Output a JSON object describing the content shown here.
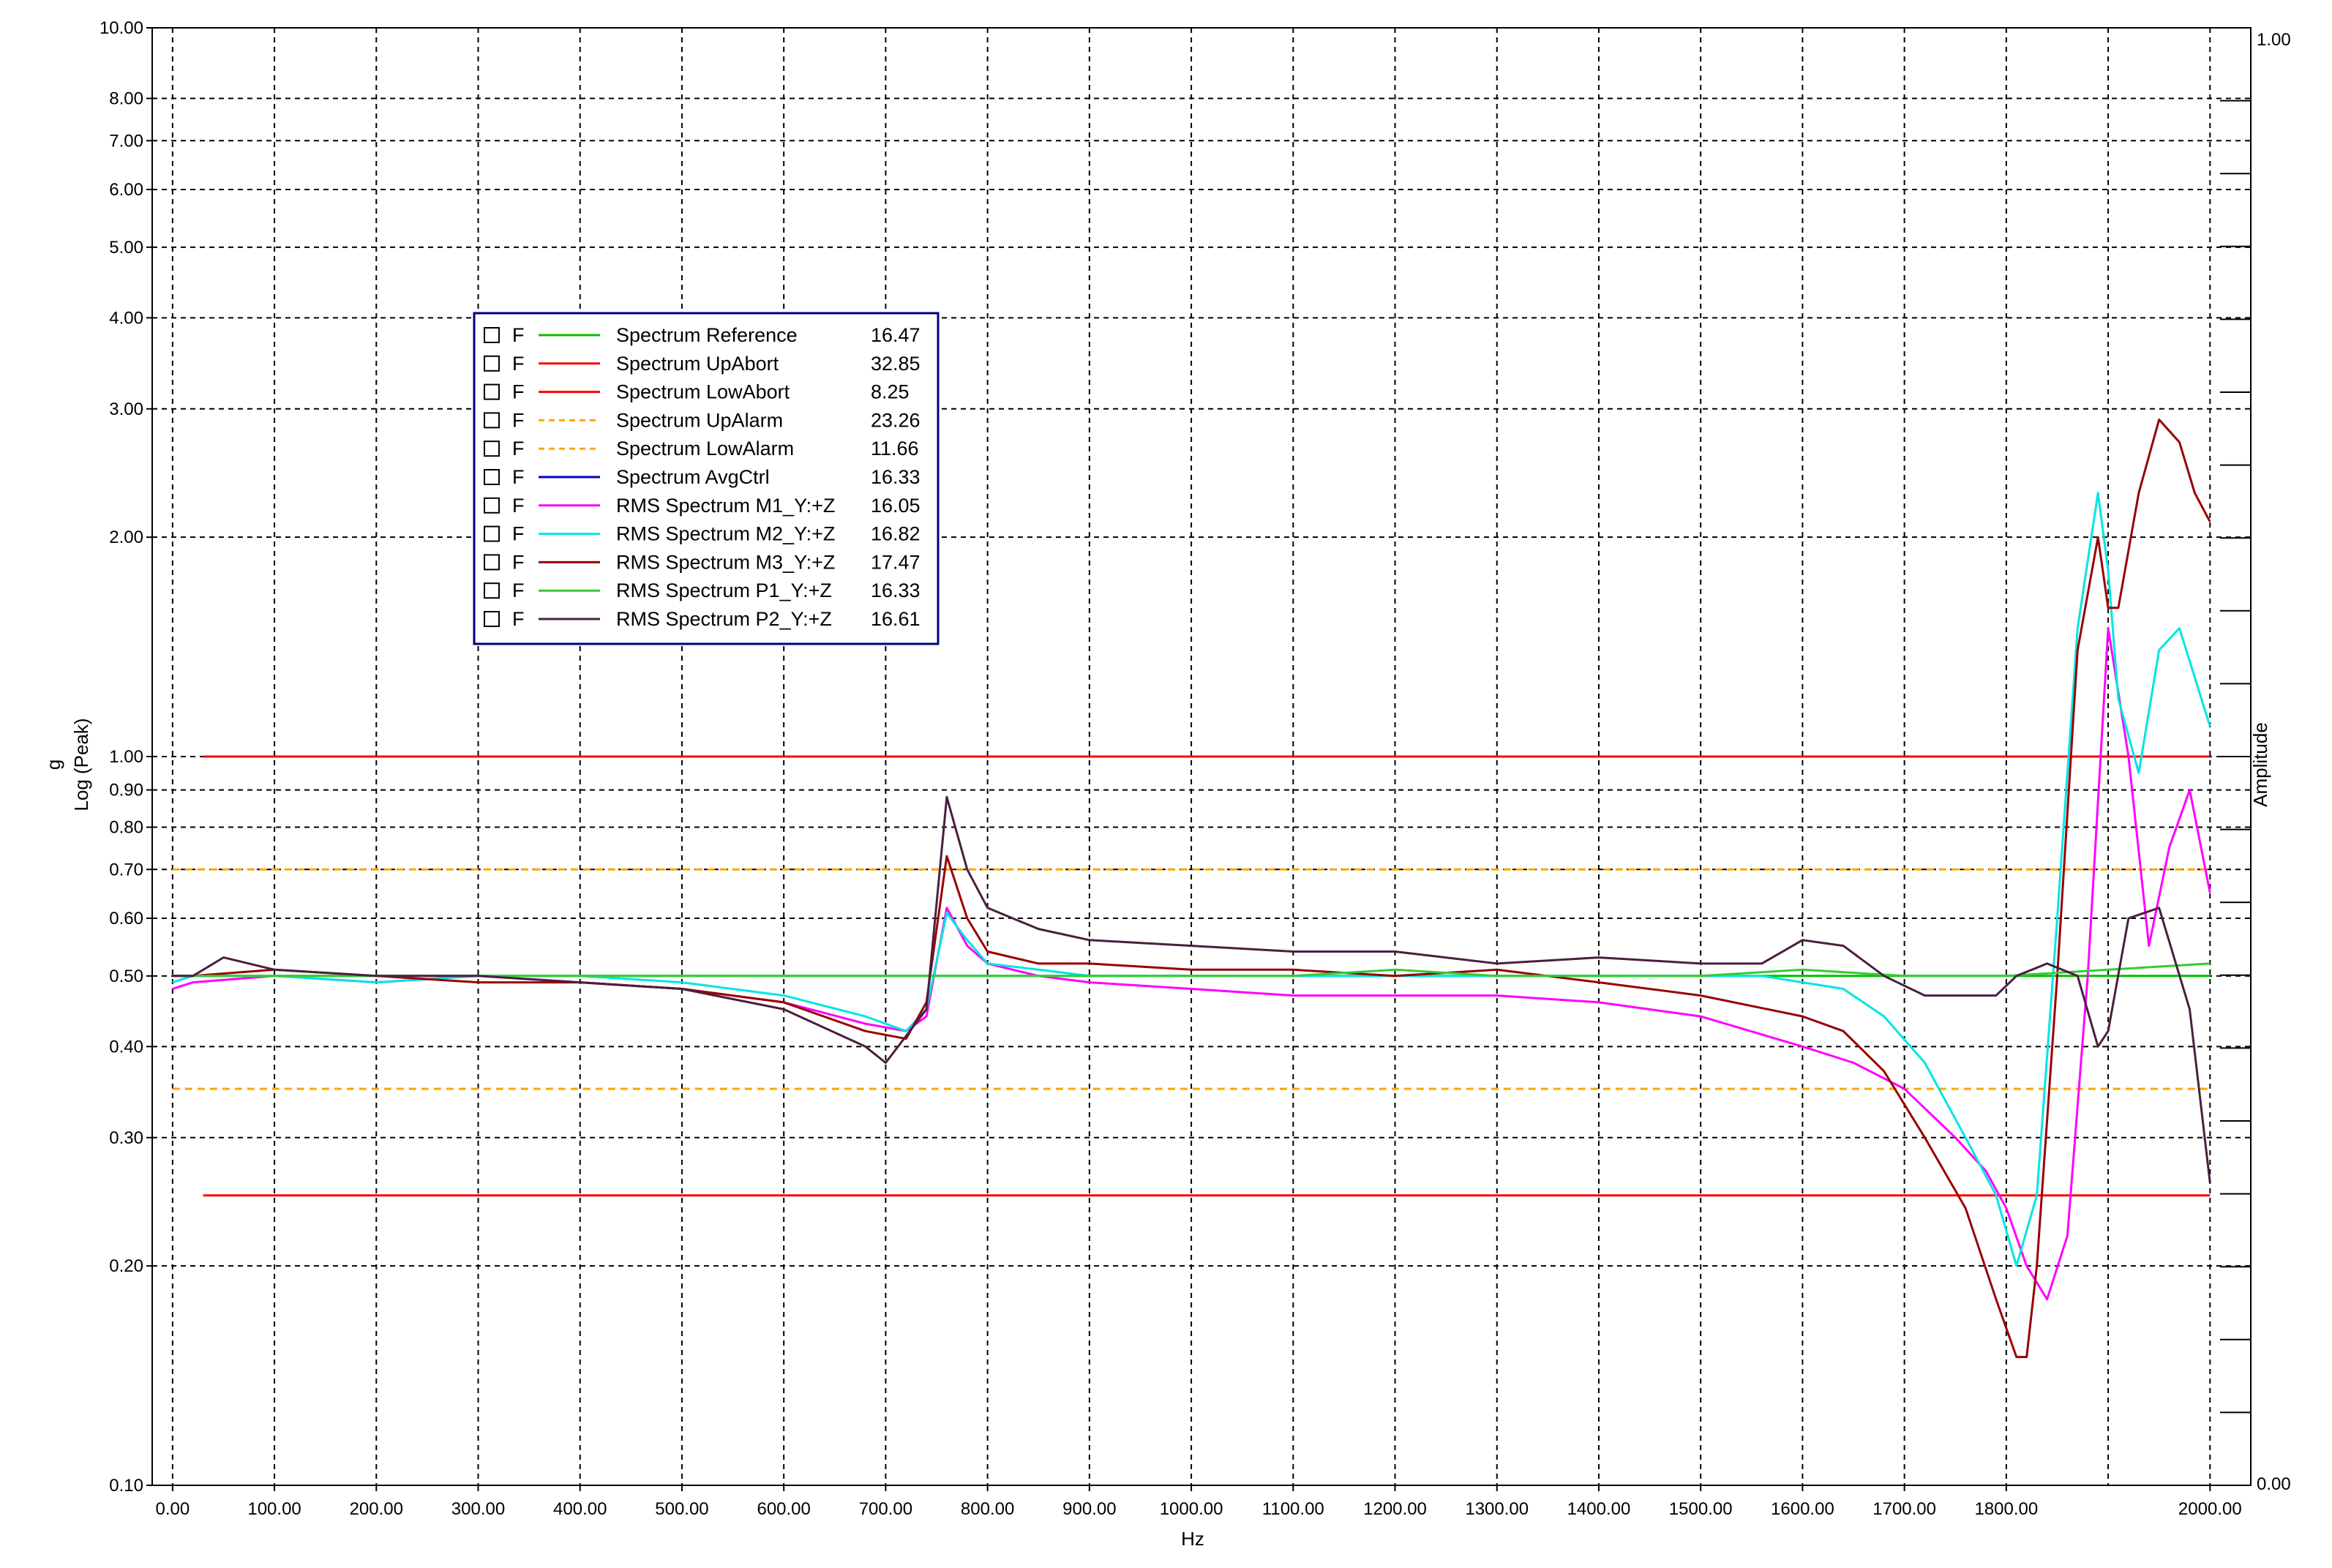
{
  "chart_data": {
    "type": "line",
    "title": "",
    "xlabel": "Hz",
    "ylabel_top": "g",
    "ylabel": "Log (Peak)",
    "y2label": "Amplitude",
    "xlim": [
      -20,
      2040
    ],
    "ylim": [
      0.1,
      10.0
    ],
    "yscale": "log",
    "y2lim": [
      0.0,
      1.0
    ],
    "grid": true,
    "legend_position": "upper-left",
    "x_ticks": [
      "0.00",
      "100.00",
      "200.00",
      "300.00",
      "400.00",
      "500.00",
      "600.00",
      "700.00",
      "800.00",
      "900.00",
      "1000.00",
      "1100.00",
      "1200.00",
      "1300.00",
      "1400.00",
      "1500.00",
      "1600.00",
      "1700.00",
      "1800.00",
      "2000.00"
    ],
    "x_tick_values": [
      0,
      100,
      200,
      300,
      400,
      500,
      600,
      700,
      800,
      900,
      1000,
      1100,
      1200,
      1300,
      1400,
      1500,
      1600,
      1700,
      1800,
      2000
    ],
    "x_extra_gridlines": [
      1900
    ],
    "y_ticks": [
      "10.00",
      "8.00",
      "7.00",
      "6.00",
      "5.00",
      "4.00",
      "3.00",
      "2.00",
      "1.00",
      "0.90",
      "0.80",
      "0.70",
      "0.60",
      "0.50",
      "0.40",
      "0.30",
      "0.20",
      "0.10"
    ],
    "y_tick_values": [
      10,
      8,
      7,
      6,
      5,
      4,
      3,
      2,
      1,
      0.9,
      0.8,
      0.7,
      0.6,
      0.5,
      0.4,
      0.3,
      0.2,
      0.1
    ],
    "y2_ticks": [
      "1.00",
      "0.00"
    ],
    "legend_box_label": "F",
    "series": [
      {
        "name": "Spectrum Reference",
        "value_label": "16.47",
        "color": "#00c000",
        "dash": "solid",
        "x": [
          0,
          2000
        ],
        "y": [
          0.5,
          0.5
        ]
      },
      {
        "name": "Spectrum UpAbort",
        "value_label": "32.85",
        "color": "#ff0000",
        "dash": "solid",
        "x": [
          30,
          2000
        ],
        "y": [
          1.0,
          1.0
        ]
      },
      {
        "name": "Spectrum LowAbort",
        "value_label": "8.25",
        "color": "#ff0000",
        "dash": "solid",
        "x": [
          30,
          2000
        ],
        "y": [
          0.25,
          0.25
        ]
      },
      {
        "name": "Spectrum UpAlarm",
        "value_label": "23.26",
        "color": "#ffa500",
        "dash": "dashed",
        "x": [
          0,
          2000
        ],
        "y": [
          0.7,
          0.7
        ]
      },
      {
        "name": "Spectrum LowAlarm",
        "value_label": "11.66",
        "color": "#ffa500",
        "dash": "dashed",
        "x": [
          0,
          2000
        ],
        "y": [
          0.35,
          0.35
        ]
      },
      {
        "name": "Spectrum AvgCtrl",
        "value_label": "16.33",
        "color": "#0000c0",
        "dash": "solid",
        "x": [],
        "y": []
      },
      {
        "name": "RMS Spectrum M1_Y:+Z",
        "value_label": "16.05",
        "color": "#ff00ff",
        "dash": "solid",
        "x": [
          0,
          20,
          100,
          200,
          300,
          400,
          500,
          600,
          680,
          720,
          740,
          760,
          780,
          800,
          850,
          900,
          1000,
          1100,
          1200,
          1300,
          1400,
          1500,
          1600,
          1650,
          1700,
          1750,
          1780,
          1800,
          1820,
          1840,
          1860,
          1880,
          1900,
          1920,
          1940,
          1960,
          1980,
          2000
        ],
        "y": [
          0.48,
          0.49,
          0.5,
          0.49,
          0.5,
          0.49,
          0.48,
          0.46,
          0.43,
          0.42,
          0.44,
          0.62,
          0.55,
          0.52,
          0.5,
          0.49,
          0.48,
          0.47,
          0.47,
          0.47,
          0.46,
          0.44,
          0.4,
          0.38,
          0.35,
          0.3,
          0.27,
          0.24,
          0.2,
          0.18,
          0.22,
          0.5,
          1.5,
          1.0,
          0.55,
          0.75,
          0.9,
          0.65
        ]
      },
      {
        "name": "RMS Spectrum M2_Y:+Z",
        "value_label": "16.82",
        "color": "#00e5e5",
        "dash": "solid",
        "x": [
          0,
          20,
          100,
          200,
          300,
          400,
          500,
          600,
          680,
          720,
          740,
          760,
          780,
          800,
          850,
          900,
          1000,
          1100,
          1200,
          1300,
          1400,
          1500,
          1560,
          1600,
          1640,
          1680,
          1720,
          1760,
          1790,
          1810,
          1830,
          1850,
          1870,
          1890,
          1900,
          1910,
          1930,
          1950,
          1970,
          2000
        ],
        "y": [
          0.49,
          0.5,
          0.5,
          0.49,
          0.5,
          0.5,
          0.49,
          0.47,
          0.44,
          0.42,
          0.45,
          0.61,
          0.56,
          0.52,
          0.51,
          0.5,
          0.5,
          0.5,
          0.5,
          0.5,
          0.5,
          0.5,
          0.5,
          0.49,
          0.48,
          0.44,
          0.38,
          0.3,
          0.25,
          0.2,
          0.25,
          0.6,
          1.5,
          2.3,
          1.8,
          1.2,
          0.95,
          1.4,
          1.5,
          1.1
        ]
      },
      {
        "name": "RMS Spectrum M3_Y:+Z",
        "value_label": "17.47",
        "color": "#990000",
        "dash": "solid",
        "x": [
          0,
          20,
          100,
          200,
          300,
          400,
          500,
          600,
          680,
          720,
          740,
          760,
          780,
          800,
          850,
          900,
          1000,
          1100,
          1200,
          1300,
          1400,
          1500,
          1600,
          1640,
          1680,
          1720,
          1760,
          1790,
          1810,
          1820,
          1830,
          1850,
          1870,
          1890,
          1900,
          1910,
          1930,
          1950,
          1970,
          1985,
          2000
        ],
        "y": [
          0.5,
          0.5,
          0.51,
          0.5,
          0.49,
          0.49,
          0.48,
          0.46,
          0.42,
          0.41,
          0.46,
          0.73,
          0.6,
          0.54,
          0.52,
          0.52,
          0.51,
          0.51,
          0.5,
          0.51,
          0.49,
          0.47,
          0.44,
          0.42,
          0.37,
          0.3,
          0.24,
          0.18,
          0.15,
          0.15,
          0.2,
          0.5,
          1.4,
          2.0,
          1.6,
          1.6,
          2.3,
          2.9,
          2.7,
          2.3,
          2.1
        ]
      },
      {
        "name": "RMS Spectrum P1_Y:+Z",
        "value_label": "16.33",
        "color": "#33cc33",
        "dash": "solid",
        "x": [
          0,
          100,
          200,
          300,
          400,
          500,
          600,
          700,
          800,
          900,
          1000,
          1100,
          1200,
          1300,
          1400,
          1500,
          1600,
          1700,
          1800,
          1900,
          2000
        ],
        "y": [
          0.5,
          0.5,
          0.5,
          0.5,
          0.5,
          0.5,
          0.5,
          0.5,
          0.5,
          0.5,
          0.5,
          0.5,
          0.51,
          0.5,
          0.5,
          0.5,
          0.51,
          0.5,
          0.5,
          0.51,
          0.52
        ]
      },
      {
        "name": "RMS Spectrum P2_Y:+Z",
        "value_label": "16.61",
        "color": "#4b1f3f",
        "dash": "solid",
        "x": [
          0,
          20,
          50,
          100,
          200,
          300,
          400,
          500,
          600,
          680,
          700,
          740,
          760,
          780,
          800,
          850,
          900,
          1000,
          1100,
          1200,
          1300,
          1400,
          1500,
          1560,
          1600,
          1640,
          1680,
          1720,
          1760,
          1790,
          1810,
          1840,
          1870,
          1890,
          1900,
          1920,
          1950,
          1980,
          2000
        ],
        "y": [
          0.5,
          0.5,
          0.53,
          0.51,
          0.5,
          0.5,
          0.49,
          0.48,
          0.45,
          0.4,
          0.38,
          0.45,
          0.88,
          0.7,
          0.62,
          0.58,
          0.56,
          0.55,
          0.54,
          0.54,
          0.52,
          0.53,
          0.52,
          0.52,
          0.56,
          0.55,
          0.5,
          0.47,
          0.47,
          0.47,
          0.5,
          0.52,
          0.5,
          0.4,
          0.42,
          0.6,
          0.62,
          0.45,
          0.26
        ]
      }
    ]
  }
}
